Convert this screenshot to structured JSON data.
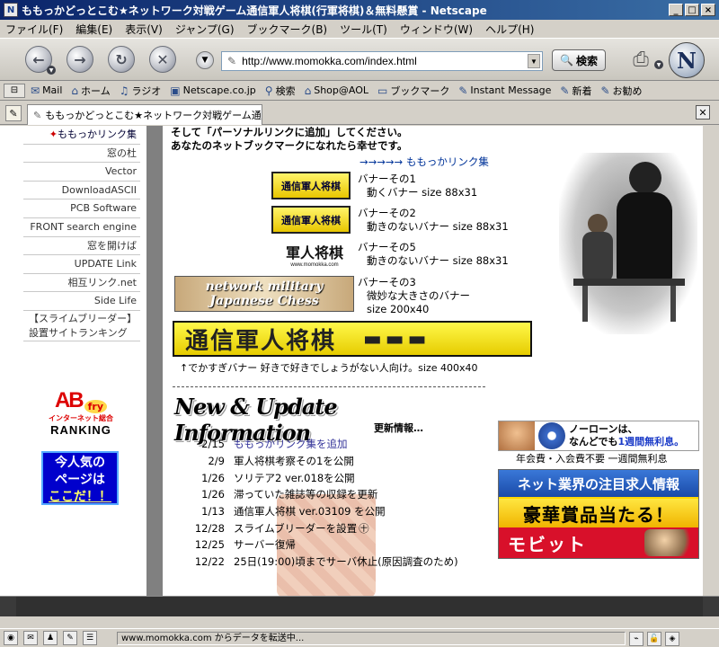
{
  "window": {
    "title": "ももっかどっとこむ★ネットワーク対戦ゲーム通信軍人将棋(行軍将棋)＆無料懸賞 - Netscape",
    "app_icon": "N",
    "minimize_glyph": "_",
    "maximize_glyph": "□",
    "close_glyph": "×"
  },
  "menu": [
    "ファイル(F)",
    "編集(E)",
    "表示(V)",
    "ジャンプ(G)",
    "ブックマーク(B)",
    "ツール(T)",
    "ウィンドウ(W)",
    "ヘルプ(H)"
  ],
  "navigation": {
    "url": "http://www.momokka.com/index.html",
    "search_label": "検索",
    "icons": [
      "back-icon",
      "forward-icon",
      "reload-icon",
      "stop-icon",
      "print-icon",
      "netscape-logo"
    ]
  },
  "personal_toolbar": [
    "Mail",
    "ホーム",
    "ラジオ",
    "Netscape.co.jp",
    "検索",
    "Shop@AOL",
    "ブックマーク",
    "Instant Message",
    "新着",
    "お勧め"
  ],
  "tab": {
    "title": "ももっかどっとこむ★ネットワーク対戦ゲーム通..."
  },
  "sidebar": {
    "items": [
      "ももっかリンク集",
      "窓の杜",
      "Vector",
      "DownloadASCII",
      "PCB Software",
      "FRONT search engine",
      "窓を開けば",
      "UPDATE Link",
      "相互リンク.net",
      "Side Life",
      "【スライムブリーダー】設置サイトランキング"
    ],
    "abfry": {
      "ab": "AB",
      "fry": "fry",
      "sub": "インターネット総合",
      "rank": "RANKING"
    },
    "popular": {
      "line1": "今人気の",
      "line2": "ページは",
      "line3": "ここだ！！"
    }
  },
  "main": {
    "intro_line1": "そして「パーソナルリンクに追加」してください。",
    "intro_line2": "あなたのネットブックマークになれたら幸せです。",
    "intro_link": "→→→→→ ももっかリンク集",
    "banners": [
      {
        "label1": "バナーその1",
        "label2": "動くバナー size 88x31",
        "image_text": "通信軍人将棋"
      },
      {
        "label1": "バナーその2",
        "label2": "動きのないバナー size 88x31",
        "image_text": "通信軍人将棋"
      },
      {
        "label1": "バナーその5",
        "label2": "動きのないバナー size 88x31",
        "image_text": "軍人将棋",
        "image_sub": "www.momokka.com"
      },
      {
        "label1": "バナーその3",
        "label2": "微妙な大きさのバナー",
        "label3": "size 200x40",
        "image_text1": "network military",
        "image_text2": "Japanese Chess"
      }
    ],
    "big_banner_text": "通信軍人将棋",
    "big_banner_tanks": "▬▬▬",
    "big_banner_caption": "↑でかすぎバナー 好きで好きでしょうがない人向け。size 400x40",
    "news_header": "New & Update Information",
    "news_header_sub": "更新情報…",
    "news": [
      {
        "date": "2/15",
        "text": "ももっかリンク集を追加",
        "link": "ももっかリンク集"
      },
      {
        "date": "2/9",
        "text": "軍人将棋考察その1を公開",
        "link": ""
      },
      {
        "date": "1/26",
        "text": "ソリテア2 ver.018を公開",
        "link": ""
      },
      {
        "date": "1/26",
        "text": "滞っていた雑誌等の収録を更新",
        "link": "雑誌等の収録"
      },
      {
        "date": "1/13",
        "text": "通信軍人将棋 ver.03109 を公開",
        "link": ""
      },
      {
        "date": "12/28",
        "text": "スライムブリーダーを設置",
        "link": ""
      },
      {
        "date": "12/25",
        "text": "サーバー復帰",
        "link": ""
      },
      {
        "date": "12/22",
        "text": "25日(19:00)頃までサーバ休止(原因調査のため)",
        "link": ""
      }
    ]
  },
  "ads": {
    "ad1_line1": "ノーローンは、",
    "ad1_line2": "なんどでも",
    "ad1_line2_blue": "1週間無利息。",
    "ad1_caption": "年会費・入会費不要 一週間無利息",
    "ad2_r1": "ネット業界の注目求人情報",
    "ad2_r2": "豪華賞品当たる！",
    "ad2_r3": "モビット"
  },
  "status": {
    "text": "www.momokka.com からデータを転送中..."
  }
}
